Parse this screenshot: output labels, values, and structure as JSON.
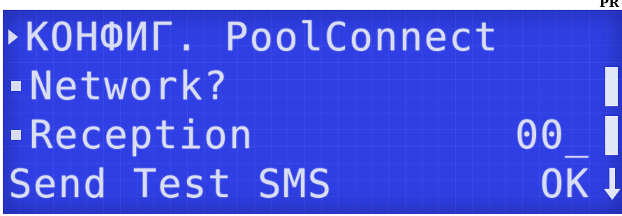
{
  "corner_fragment": "PR",
  "lcd": {
    "row1": {
      "title": "КОНФИГ. PoolConnect"
    },
    "row2": {
      "label": "Network?"
    },
    "row3": {
      "label": "Reception",
      "value": "00_"
    },
    "row4": {
      "label": "Send Test SMS",
      "value": "OK"
    }
  },
  "icons": {
    "selection": "right-triangle-icon",
    "item_marker": "square-bullet-icon",
    "scroll_down": "down-arrow-icon"
  },
  "colors": {
    "lcd_background": "#2f3fe4",
    "lcd_text": "#d9ddf3"
  }
}
